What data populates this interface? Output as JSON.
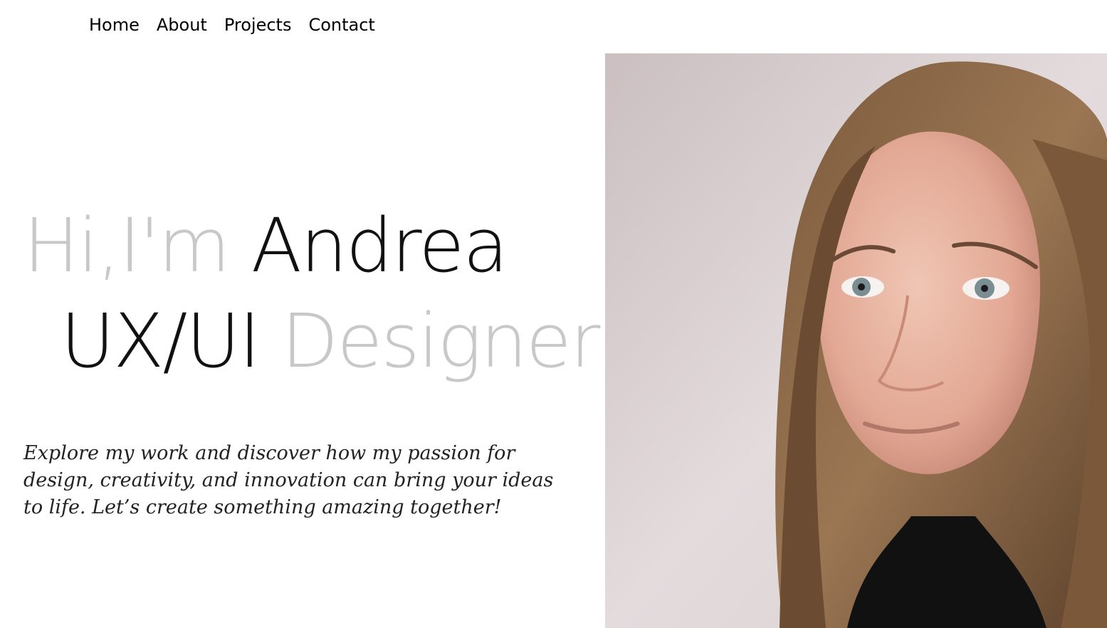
{
  "nav": {
    "items": [
      {
        "label": "Home"
      },
      {
        "label": "About"
      },
      {
        "label": "Projects"
      },
      {
        "label": "Contact"
      }
    ]
  },
  "hero": {
    "greeting": "Hi,I'm",
    "name": "Andrea",
    "role_prefix": "UX/UI",
    "role_suffix": "Designer",
    "intro": "Explore my work and discover how my passion for design, creativity, and innovation can bring your ideas to life. Let’s create something amazing together!"
  },
  "colors": {
    "muted_text": "#c8c8c8",
    "dark_text": "#111111",
    "background": "#ffffff"
  }
}
